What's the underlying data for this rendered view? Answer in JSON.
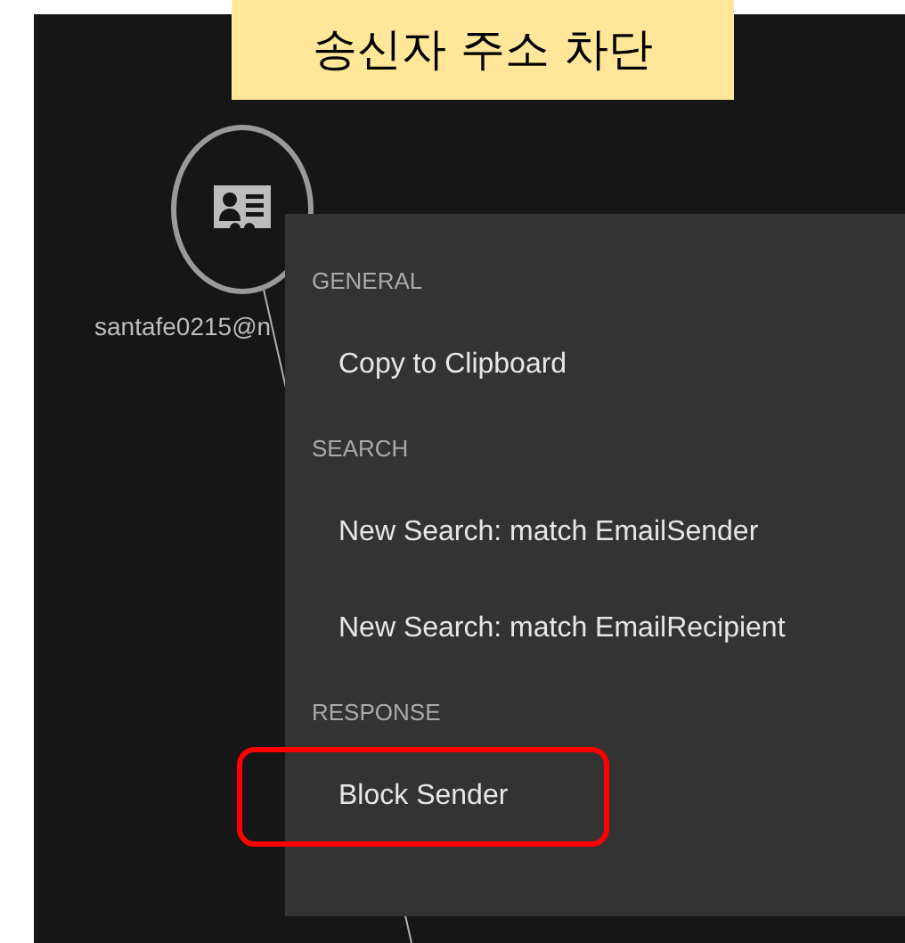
{
  "caption": "송신자 주소 차단",
  "node": {
    "label": "santafe0215@n"
  },
  "context_menu": {
    "sections": [
      {
        "heading": "GENERAL",
        "items": [
          {
            "label": "Copy to Clipboard",
            "highlighted": false
          }
        ]
      },
      {
        "heading": "SEARCH",
        "items": [
          {
            "label": "New Search: match EmailSender",
            "highlighted": false
          },
          {
            "label": "New Search: match EmailRecipient",
            "highlighted": false
          }
        ]
      },
      {
        "heading": "RESPONSE",
        "items": [
          {
            "label": "Block Sender",
            "highlighted": true
          }
        ]
      }
    ]
  }
}
